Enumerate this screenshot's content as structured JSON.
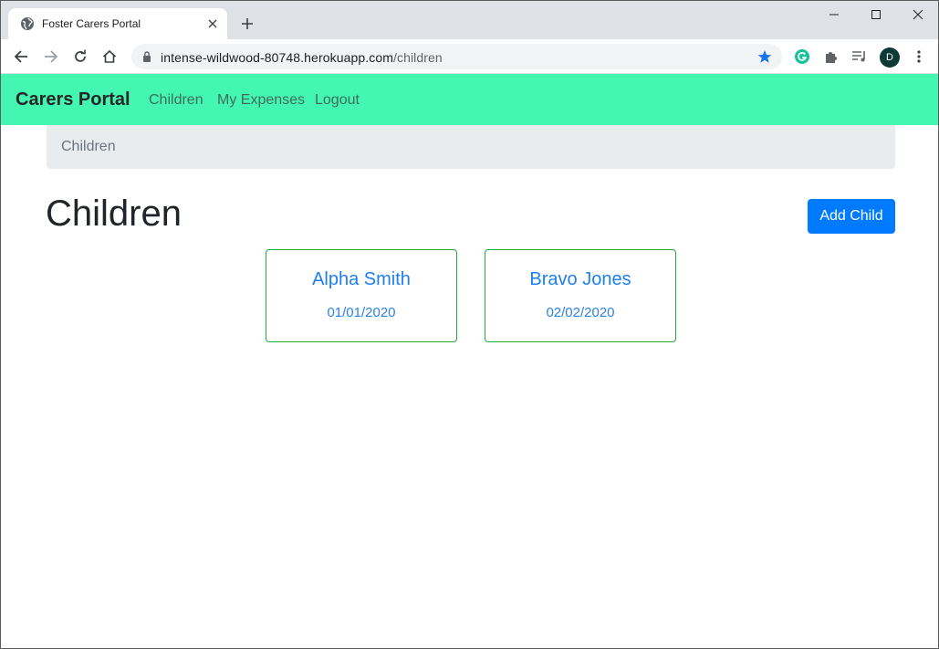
{
  "browser": {
    "tab_title": "Foster Carers Portal",
    "url_host": "intense-wildwood-80748.herokuapp.com",
    "url_path": "/children",
    "profile_initial": "D"
  },
  "nav": {
    "brand": "Carers Portal",
    "links": [
      "Children",
      "My Expenses",
      "Logout"
    ]
  },
  "breadcrumb": [
    "Children"
  ],
  "page": {
    "title": "Children",
    "add_button": "Add Child"
  },
  "children": [
    {
      "name": "Alpha Smith",
      "dob": "01/01/2020"
    },
    {
      "name": "Bravo Jones",
      "dob": "02/02/2020"
    }
  ],
  "colors": {
    "navbar": "#44f7b1",
    "primary": "#007bff",
    "card_border": "#28a745"
  }
}
